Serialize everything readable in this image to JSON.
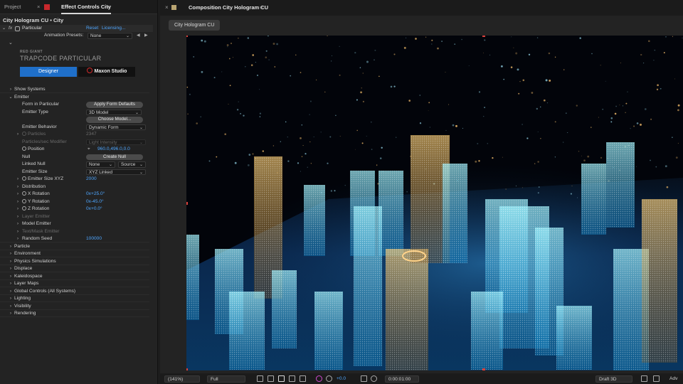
{
  "left_panel": {
    "tabs": {
      "project": "Project",
      "close": "×",
      "effect": "Effect Controls City",
      "menu": "≡"
    },
    "breadcrumb": "City Hologram CU • City",
    "fx_row": {
      "fx": "fx",
      "effect_name": "Particular",
      "reset": "Reset",
      "licensing": "Licensing..."
    },
    "presets": {
      "label": "Animation Presets:",
      "value": "None"
    },
    "brand": {
      "top": "RED GIANT",
      "name": "TRAPCODE PARTICULAR"
    },
    "buttons": {
      "designer": "Designer",
      "maxon": "Maxon Studio"
    },
    "rows": {
      "show_systems": "Show Systems",
      "emitter": "Emitter",
      "form_in_particular": "Form in Particular",
      "apply_form_defaults": "Apply Form Defaults",
      "emitter_type": "Emitter Type",
      "emitter_type_value": "3D Model",
      "choose_model": "Choose Model...",
      "emitter_behavior": "Emitter Behavior",
      "emitter_behavior_value": "Dynamic Form",
      "particles": "Particles",
      "particles_value": "2347",
      "particles_sec_modifier": "Particles/sec Modifier",
      "particles_sec_modifier_value": "Light Intensity",
      "position": "Position",
      "position_value": "960.0,496.0,0.0",
      "null": "Null",
      "create_null": "Create Null",
      "linked_null": "Linked Null",
      "linked_null_value": "None",
      "linked_null_source": "Source",
      "emitter_size": "Emitter Size",
      "emitter_size_value": "XYZ Linked",
      "emitter_size_xyz": "Emitter Size XYZ",
      "emitter_size_xyz_value": "2000",
      "distribution": "Distribution",
      "x_rotation": "X Rotation",
      "x_rotation_value": "0x+25.0°",
      "y_rotation": "Y Rotation",
      "y_rotation_value": "0x-45.0°",
      "z_rotation": "Z Rotation",
      "z_rotation_value": "0x+0.0°",
      "layer_emitter": "Layer Emitter",
      "model_emitter": "Model Emitter",
      "text_mask_emitter": "Text/Mask Emitter",
      "random_seed": "Random Seed",
      "random_seed_value": "100000",
      "particle": "Particle",
      "environment": "Environment",
      "physics_simulations": "Physics Simulations",
      "displace": "Displace",
      "kaleidospace": "Kaleidospace",
      "layer_maps": "Layer Maps",
      "global_controls": "Global Controls (All Systems)",
      "lighting": "Lighting",
      "visibility": "Visibility",
      "rendering": "Rendering"
    }
  },
  "right_panel": {
    "tab": {
      "close": "×",
      "title": "Composition City Hologram CU",
      "menu": "≡"
    },
    "comp_tab": "City Hologram CU",
    "bottom_bar": {
      "zoom": "(141%)",
      "resolution": "Full",
      "exposure": "+0.0",
      "timecode": "0:00:01:00",
      "renderer": "Draft 3D",
      "adv": "Adv"
    }
  },
  "colors": {
    "accent_blue": "#4ea6ff",
    "designer_blue": "#1f6fc9",
    "red_swatch": "#c8282c",
    "comp_swatch": "#b9a572"
  }
}
